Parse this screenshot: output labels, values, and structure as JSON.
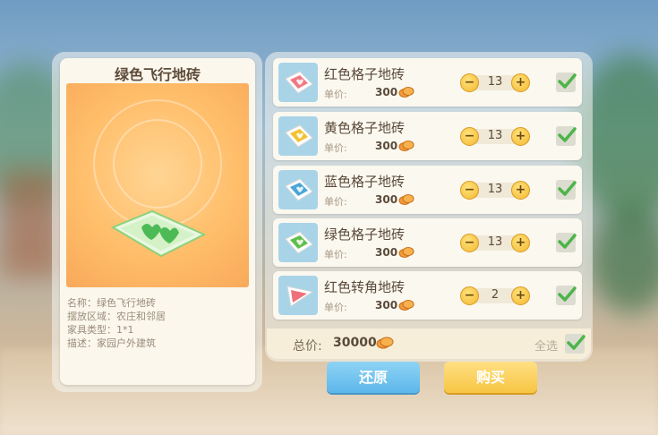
{
  "item_detail": {
    "title": "绿色飞行地砖",
    "info": [
      "名称：绿色飞行地砖",
      "摆放区域：农庄和邻居",
      "家具类型：1*1",
      "描述：家园户外建筑"
    ]
  },
  "cart": {
    "items": [
      {
        "name": "红色格子地砖",
        "price_label": "单价:",
        "price": "300",
        "qty": "13",
        "checked": true,
        "tile_color": "#ef7a86"
      },
      {
        "name": "黄色格子地砖",
        "price_label": "单价:",
        "price": "300",
        "qty": "13",
        "checked": true,
        "tile_color": "#f2c232"
      },
      {
        "name": "蓝色格子地砖",
        "price_label": "单价:",
        "price": "300",
        "qty": "13",
        "checked": true,
        "tile_color": "#4aa6d8"
      },
      {
        "name": "绿色格子地砖",
        "price_label": "单价:",
        "price": "300",
        "qty": "13",
        "checked": true,
        "tile_color": "#5fbf4a"
      },
      {
        "name": "红色转角地砖",
        "price_label": "单价:",
        "price": "300",
        "qty": "2",
        "checked": true,
        "tile_color": "#ef6f7a"
      }
    ],
    "total_label": "总价:",
    "total_value": "30000",
    "select_all_label": "全选",
    "select_all_checked": true
  },
  "buttons": {
    "restore": "还原",
    "buy": "购买"
  },
  "icons": {
    "currency": "coin-icon",
    "check": "check-icon",
    "minus": "−",
    "plus": "+"
  }
}
